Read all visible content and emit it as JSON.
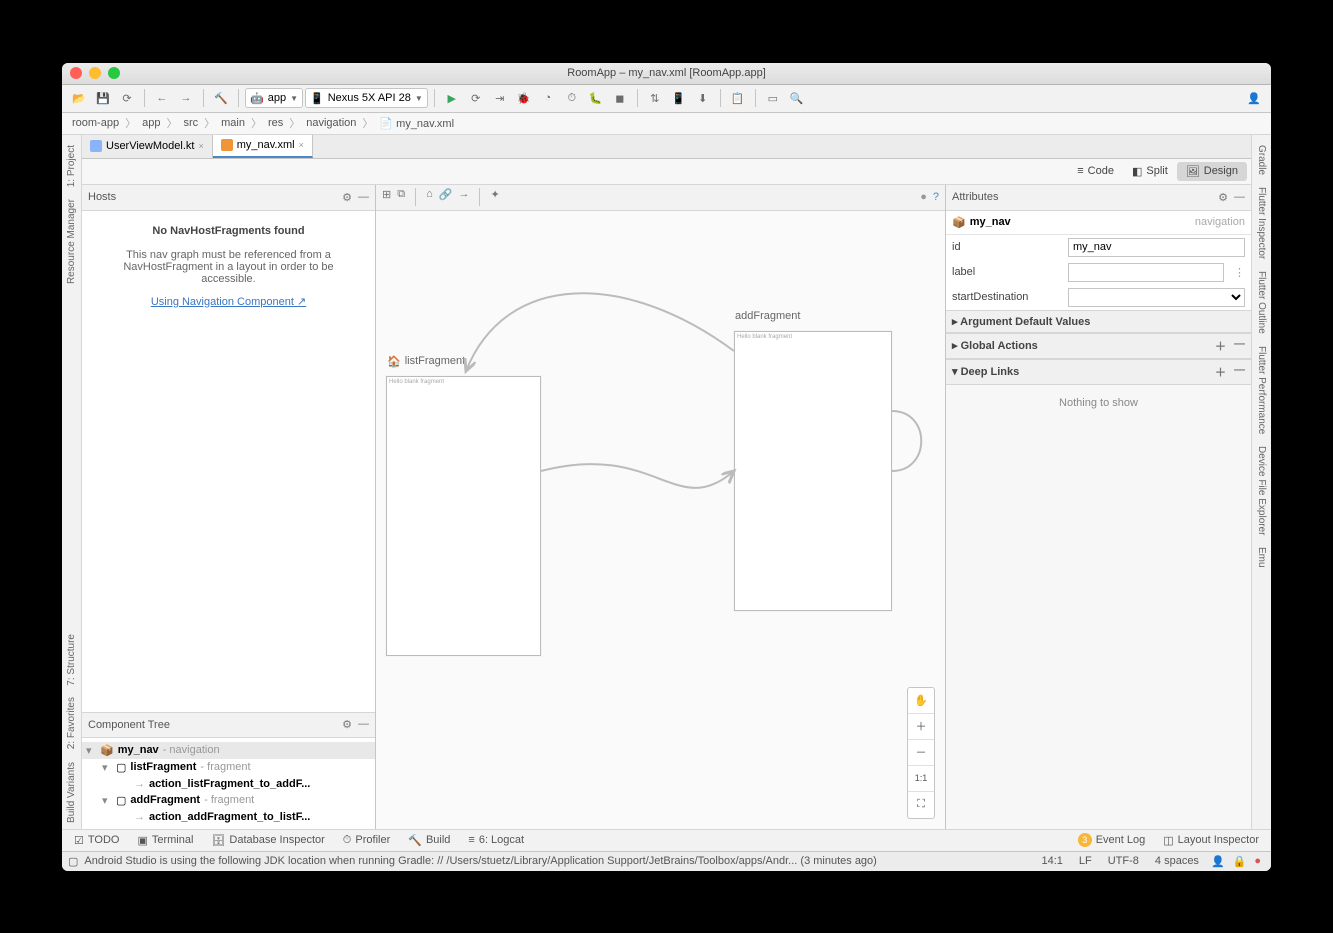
{
  "window": {
    "title": "RoomApp – my_nav.xml [RoomApp.app]"
  },
  "toolbar": {
    "module": "app",
    "device": "Nexus 5X API 28"
  },
  "breadcrumb": [
    "room-app",
    "app",
    "src",
    "main",
    "res",
    "navigation",
    "my_nav.xml"
  ],
  "editor_tabs": [
    {
      "label": "UserViewModel.kt",
      "active": false
    },
    {
      "label": "my_nav.xml",
      "active": true
    }
  ],
  "left_tools": [
    "1: Project",
    "Resource Manager",
    "7: Structure",
    "2: Favorites",
    "Build Variants"
  ],
  "right_tools": [
    "Gradle",
    "Flutter Inspector",
    "Flutter Outline",
    "Flutter Performance",
    "Device File Explorer",
    "Emu"
  ],
  "view_modes": {
    "code": "Code",
    "split": "Split",
    "design": "Design"
  },
  "hosts": {
    "title": "Hosts",
    "empty_title": "No NavHostFragments found",
    "empty_body": "This nav graph must be referenced from a NavHostFragment in a layout in order to be accessible.",
    "link": "Using Navigation Component ↗"
  },
  "component_tree": {
    "title": "Component Tree",
    "root": {
      "name": "my_nav",
      "type": "navigation"
    },
    "children": [
      {
        "name": "listFragment",
        "type": "fragment",
        "actions": [
          "action_listFragment_to_addF..."
        ]
      },
      {
        "name": "addFragment",
        "type": "fragment",
        "actions": [
          "action_addFragment_to_listF..."
        ]
      }
    ]
  },
  "canvas": {
    "fragments": [
      {
        "id": "listFragment",
        "home": true,
        "text": "Hello blank fragment"
      },
      {
        "id": "addFragment",
        "home": false,
        "text": "Hello blank fragment"
      }
    ]
  },
  "attributes": {
    "title": "Attributes",
    "nav_name": "my_nav",
    "nav_type": "navigation",
    "fields": {
      "id_label": "id",
      "id_value": "my_nav",
      "label_label": "label",
      "label_value": "",
      "start_label": "startDestination",
      "start_value": ""
    },
    "sections": [
      "Argument Default Values",
      "Global Actions",
      "Deep Links"
    ],
    "nothing": "Nothing to show"
  },
  "bottom": {
    "tools": [
      "TODO",
      "Terminal",
      "Database Inspector",
      "Profiler",
      "Build",
      "6: Logcat"
    ],
    "event_log": "Event Log",
    "event_badge": "3",
    "layout_inspector": "Layout Inspector"
  },
  "status": {
    "msg": "Android Studio is using the following JDK location when running Gradle: // /Users/stuetz/Library/Application Support/JetBrains/Toolbox/apps/Andr... (3 minutes ago)",
    "pos": "14:1",
    "lf": "LF",
    "enc": "UTF-8",
    "indent": "4 spaces"
  }
}
